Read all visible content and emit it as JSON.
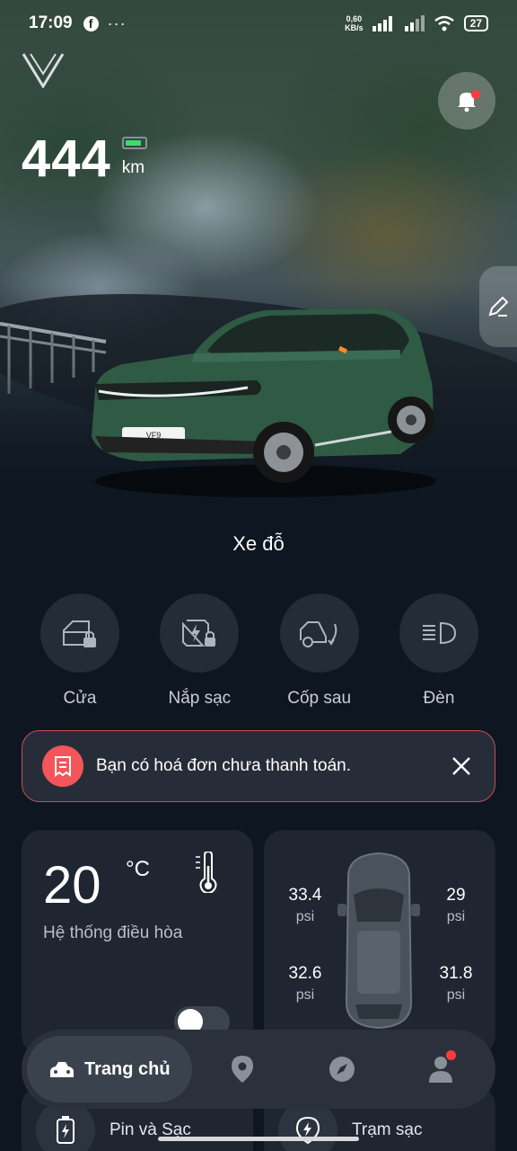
{
  "status_bar": {
    "time": "17:09",
    "net_speed_value": "0,60",
    "net_speed_unit": "KB/s",
    "battery": "27"
  },
  "vehicle": {
    "range_value": "444",
    "range_unit": "km",
    "state": "Xe đỗ",
    "model_badge": "VF9"
  },
  "controls": [
    {
      "label": "Cửa",
      "icon": "door-lock-icon"
    },
    {
      "label": "Nắp sạc",
      "icon": "charge-port-lock-icon"
    },
    {
      "label": "Cốp sau",
      "icon": "trunk-icon"
    },
    {
      "label": "Đèn",
      "icon": "headlight-icon"
    }
  ],
  "alert": {
    "message": "Bạn có hoá đơn chưa thanh toán.",
    "icon": "bill-icon",
    "color": "#f2555a"
  },
  "climate": {
    "temperature": "20",
    "unit": "°C",
    "title": "Hệ thống điều hòa",
    "enabled": false
  },
  "tires": {
    "front_left": "33.4",
    "front_right": "29",
    "rear_left": "32.6",
    "rear_right": "31.8",
    "unit": "psi"
  },
  "quick_actions": [
    {
      "label": "Pin và Sạc",
      "icon": "battery-charge-icon"
    },
    {
      "label": "Trạm sạc",
      "icon": "charging-station-icon"
    }
  ],
  "nav": {
    "home_label": "Trang chủ",
    "items": [
      "home-icon",
      "location-icon",
      "compass-icon",
      "profile-icon"
    ]
  },
  "colors": {
    "background": "#0e1621",
    "card": "#1f2631",
    "alert_border": "#c54f55",
    "notification_dot": "#ff3b3b"
  }
}
